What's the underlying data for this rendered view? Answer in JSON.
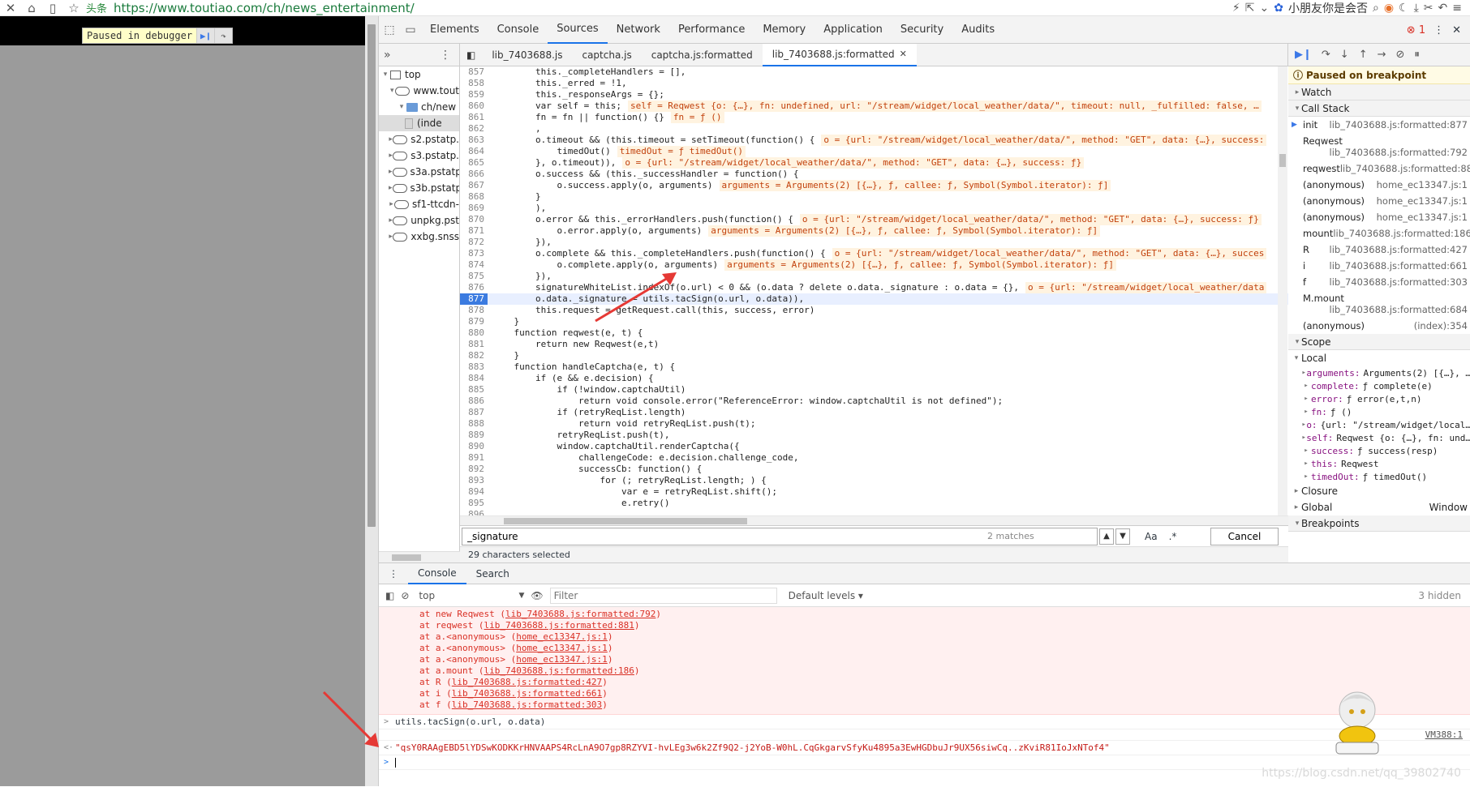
{
  "browser": {
    "tab_label": "头条",
    "url": "https://www.toutiao.com/ch/news_entertainment/",
    "user_name": "小朋友你是会否"
  },
  "page": {
    "debug_badge": "Paused in debugger"
  },
  "devtools": {
    "tabs": [
      "Elements",
      "Console",
      "Sources",
      "Network",
      "Performance",
      "Memory",
      "Application",
      "Security",
      "Audits"
    ],
    "active_tab": "Sources",
    "error_count": "1",
    "navigator": {
      "items": [
        {
          "label": "top",
          "depth": 0
        },
        {
          "label": "www.tout",
          "depth": 1
        },
        {
          "label": "ch/new",
          "depth": 2
        },
        {
          "label": "(inde",
          "depth": 3
        },
        {
          "label": "s2.pstatp.",
          "depth": 1
        },
        {
          "label": "s3.pstatp.",
          "depth": 1
        },
        {
          "label": "s3a.pstatp",
          "depth": 1
        },
        {
          "label": "s3b.pstatp",
          "depth": 1
        },
        {
          "label": "sf1-ttcdn-",
          "depth": 1
        },
        {
          "label": "unpkg.pst",
          "depth": 1
        },
        {
          "label": "xxbg.snss",
          "depth": 1
        }
      ]
    },
    "editor_tabs": [
      "lib_7403688.js",
      "captcha.js",
      "captcha.js:formatted",
      "lib_7403688.js:formatted"
    ],
    "active_editor_tab": "lib_7403688.js:formatted",
    "code_lines": [
      {
        "n": "857",
        "code": "        this._completeHandlers = [],",
        "inline": ""
      },
      {
        "n": "858",
        "code": "        this._erred = !1,",
        "inline": ""
      },
      {
        "n": "859",
        "code": "        this._responseArgs = {};",
        "inline": ""
      },
      {
        "n": "860",
        "code": "        var self = this;",
        "inline": "self = Reqwest {o: {…}, fn: undefined, url: \"/stream/widget/local_weather/data/\", timeout: null, _fulfilled: false, …"
      },
      {
        "n": "861",
        "code": "        fn = fn || function() {}",
        "inline": "fn = ƒ ()"
      },
      {
        "n": "862",
        "code": "        ,",
        "inline": ""
      },
      {
        "n": "863",
        "code": "        o.timeout && (this.timeout = setTimeout(function() {",
        "inline": "o = {url: \"/stream/widget/local_weather/data/\", method: \"GET\", data: {…}, success:"
      },
      {
        "n": "864",
        "code": "            timedOut()",
        "inline": "timedOut = ƒ timedOut()"
      },
      {
        "n": "865",
        "code": "        }, o.timeout)),",
        "inline": "o = {url: \"/stream/widget/local_weather/data/\", method: \"GET\", data: {…}, success: ƒ}"
      },
      {
        "n": "866",
        "code": "        o.success && (this._successHandler = function() {",
        "inline": ""
      },
      {
        "n": "867",
        "code": "            o.success.apply(o, arguments)",
        "inline": "arguments = Arguments(2) [{…}, ƒ, callee: ƒ, Symbol(Symbol.iterator): ƒ]"
      },
      {
        "n": "868",
        "code": "        }",
        "inline": ""
      },
      {
        "n": "869",
        "code": "        ),",
        "inline": ""
      },
      {
        "n": "870",
        "code": "        o.error && this._errorHandlers.push(function() {",
        "inline": "o = {url: \"/stream/widget/local_weather/data/\", method: \"GET\", data: {…}, success: ƒ}"
      },
      {
        "n": "871",
        "code": "            o.error.apply(o, arguments)",
        "inline": "arguments = Arguments(2) [{…}, ƒ, callee: ƒ, Symbol(Symbol.iterator): ƒ]"
      },
      {
        "n": "872",
        "code": "        }),",
        "inline": ""
      },
      {
        "n": "873",
        "code": "        o.complete && this._completeHandlers.push(function() {",
        "inline": "o = {url: \"/stream/widget/local_weather/data/\", method: \"GET\", data: {…}, succes"
      },
      {
        "n": "874",
        "code": "            o.complete.apply(o, arguments)",
        "inline": "arguments = Arguments(2) [{…}, ƒ, callee: ƒ, Symbol(Symbol.iterator): ƒ]"
      },
      {
        "n": "875",
        "code": "        }),",
        "inline": ""
      },
      {
        "n": "876",
        "code": "        signatureWhiteList.indexOf(o.url) < 0 && (o.data ? delete o.data._signature : o.data = {},",
        "inline": "o = {url: \"/stream/widget/local_weather/data"
      },
      {
        "n": "877",
        "code": "        o.data._signature = utils.tacSign(o.url, o.data)),",
        "inline": ""
      },
      {
        "n": "878",
        "code": "        this.request = getRequest.call(this, success, error)",
        "inline": ""
      },
      {
        "n": "879",
        "code": "    }",
        "inline": ""
      },
      {
        "n": "880",
        "code": "    function reqwest(e, t) {",
        "inline": ""
      },
      {
        "n": "881",
        "code": "        return new Reqwest(e,t)",
        "inline": ""
      },
      {
        "n": "882",
        "code": "    }",
        "inline": ""
      },
      {
        "n": "883",
        "code": "    function handleCaptcha(e, t) {",
        "inline": ""
      },
      {
        "n": "884",
        "code": "        if (e && e.decision) {",
        "inline": ""
      },
      {
        "n": "885",
        "code": "            if (!window.captchaUtil)",
        "inline": ""
      },
      {
        "n": "886",
        "code": "                return void console.error(\"ReferenceError: window.captchaUtil is not defined\");",
        "inline": ""
      },
      {
        "n": "887",
        "code": "            if (retryReqList.length)",
        "inline": ""
      },
      {
        "n": "888",
        "code": "                return void retryReqList.push(t);",
        "inline": ""
      },
      {
        "n": "889",
        "code": "            retryReqList.push(t),",
        "inline": ""
      },
      {
        "n": "890",
        "code": "            window.captchaUtil.renderCaptcha({",
        "inline": ""
      },
      {
        "n": "891",
        "code": "                challengeCode: e.decision.challenge_code,",
        "inline": ""
      },
      {
        "n": "892",
        "code": "                successCb: function() {",
        "inline": ""
      },
      {
        "n": "893",
        "code": "                    for (; retryReqList.length; ) {",
        "inline": ""
      },
      {
        "n": "894",
        "code": "                        var e = retryReqList.shift();",
        "inline": ""
      },
      {
        "n": "895",
        "code": "                        e.retry()",
        "inline": ""
      },
      {
        "n": "896",
        "code": "",
        "inline": ""
      }
    ],
    "breakpoint_line": "877",
    "search": {
      "value": "_signature",
      "matches": "2 matches",
      "case_label": "Aa",
      "regex_label": ".*",
      "cancel": "Cancel"
    },
    "status": "29 characters selected",
    "debugger": {
      "paused_msg": "Paused on breakpoint",
      "watch": "Watch",
      "call_stack": "Call Stack",
      "frames": [
        {
          "fn": "init",
          "loc": "lib_7403688.js:formatted:877",
          "two": false
        },
        {
          "fn": "Reqwest",
          "loc": "lib_7403688.js:formatted:792",
          "two": true
        },
        {
          "fn": "reqwest",
          "loc": "lib_7403688.js:formatted:881",
          "two": false
        },
        {
          "fn": "(anonymous)",
          "loc": "home_ec13347.js:1",
          "two": false
        },
        {
          "fn": "(anonymous)",
          "loc": "home_ec13347.js:1",
          "two": false
        },
        {
          "fn": "(anonymous)",
          "loc": "home_ec13347.js:1",
          "two": false
        },
        {
          "fn": "mount",
          "loc": "lib_7403688.js:formatted:186",
          "two": false
        },
        {
          "fn": "R",
          "loc": "lib_7403688.js:formatted:427",
          "two": false
        },
        {
          "fn": "i",
          "loc": "lib_7403688.js:formatted:661",
          "two": false
        },
        {
          "fn": "f",
          "loc": "lib_7403688.js:formatted:303",
          "two": false
        },
        {
          "fn": "M.mount",
          "loc": "lib_7403688.js:formatted:684",
          "two": true
        },
        {
          "fn": "(anonymous)",
          "loc": "(index):354",
          "two": false
        }
      ],
      "scope": "Scope",
      "local": "Local",
      "locals": [
        {
          "k": "arguments:",
          "v": "Arguments(2) [{…}, …"
        },
        {
          "k": "complete:",
          "v": "ƒ complete(e)"
        },
        {
          "k": "error:",
          "v": "ƒ error(e,t,n)"
        },
        {
          "k": "fn:",
          "v": "ƒ ()"
        },
        {
          "k": "o:",
          "v": "{url: \"/stream/widget/local…"
        },
        {
          "k": "self:",
          "v": "Reqwest {o: {…}, fn: und…"
        },
        {
          "k": "success:",
          "v": "ƒ success(resp)"
        },
        {
          "k": "this:",
          "v": "Reqwest"
        },
        {
          "k": "timedOut:",
          "v": "ƒ timedOut()"
        }
      ],
      "closure": "Closure",
      "global": "Global",
      "global_val": "Window",
      "breakpoints": "Breakpoints"
    },
    "drawer": {
      "tabs": [
        "Console",
        "Search"
      ],
      "active_tab": "Console",
      "context": "top",
      "filter_placeholder": "Filter",
      "levels": "Default levels ▾",
      "hidden": "3 hidden",
      "trace": [
        {
          "pre": "at new Reqwest (",
          "link": "lib_7403688.js:formatted:792",
          "post": ")"
        },
        {
          "pre": "at reqwest (",
          "link": "lib_7403688.js:formatted:881",
          "post": ")"
        },
        {
          "pre": "at a.<anonymous> (",
          "link": "home_ec13347.js:1",
          "post": ")"
        },
        {
          "pre": "at a.<anonymous> (",
          "link": "home_ec13347.js:1",
          "post": ")"
        },
        {
          "pre": "at a.<anonymous> (",
          "link": "home_ec13347.js:1",
          "post": ")"
        },
        {
          "pre": "at a.mount (",
          "link": "lib_7403688.js:formatted:186",
          "post": ")"
        },
        {
          "pre": "at R (",
          "link": "lib_7403688.js:formatted:427",
          "post": ")"
        },
        {
          "pre": "at i (",
          "link": "lib_7403688.js:formatted:661",
          "post": ")"
        },
        {
          "pre": "at f (",
          "link": "lib_7403688.js:formatted:303",
          "post": ")"
        }
      ],
      "input_cmd": "utils.tacSign(o.url, o.data)",
      "vm_loc": "VM388:1",
      "result": "\"qsY0RAAgEBD5lYDSwKODKKrHNVAAPS4RcLnA9O7gp8RZYVI-hvLEg3w6k2Zf9Q2-j2YoB-W0hL.CqGkgarvSfyKu4895a3EwHGDbuJr9UX56siwCq..zKviR81IoJxNTof4\""
    },
    "watermark": "https://blog.csdn.net/qq_39802740"
  }
}
